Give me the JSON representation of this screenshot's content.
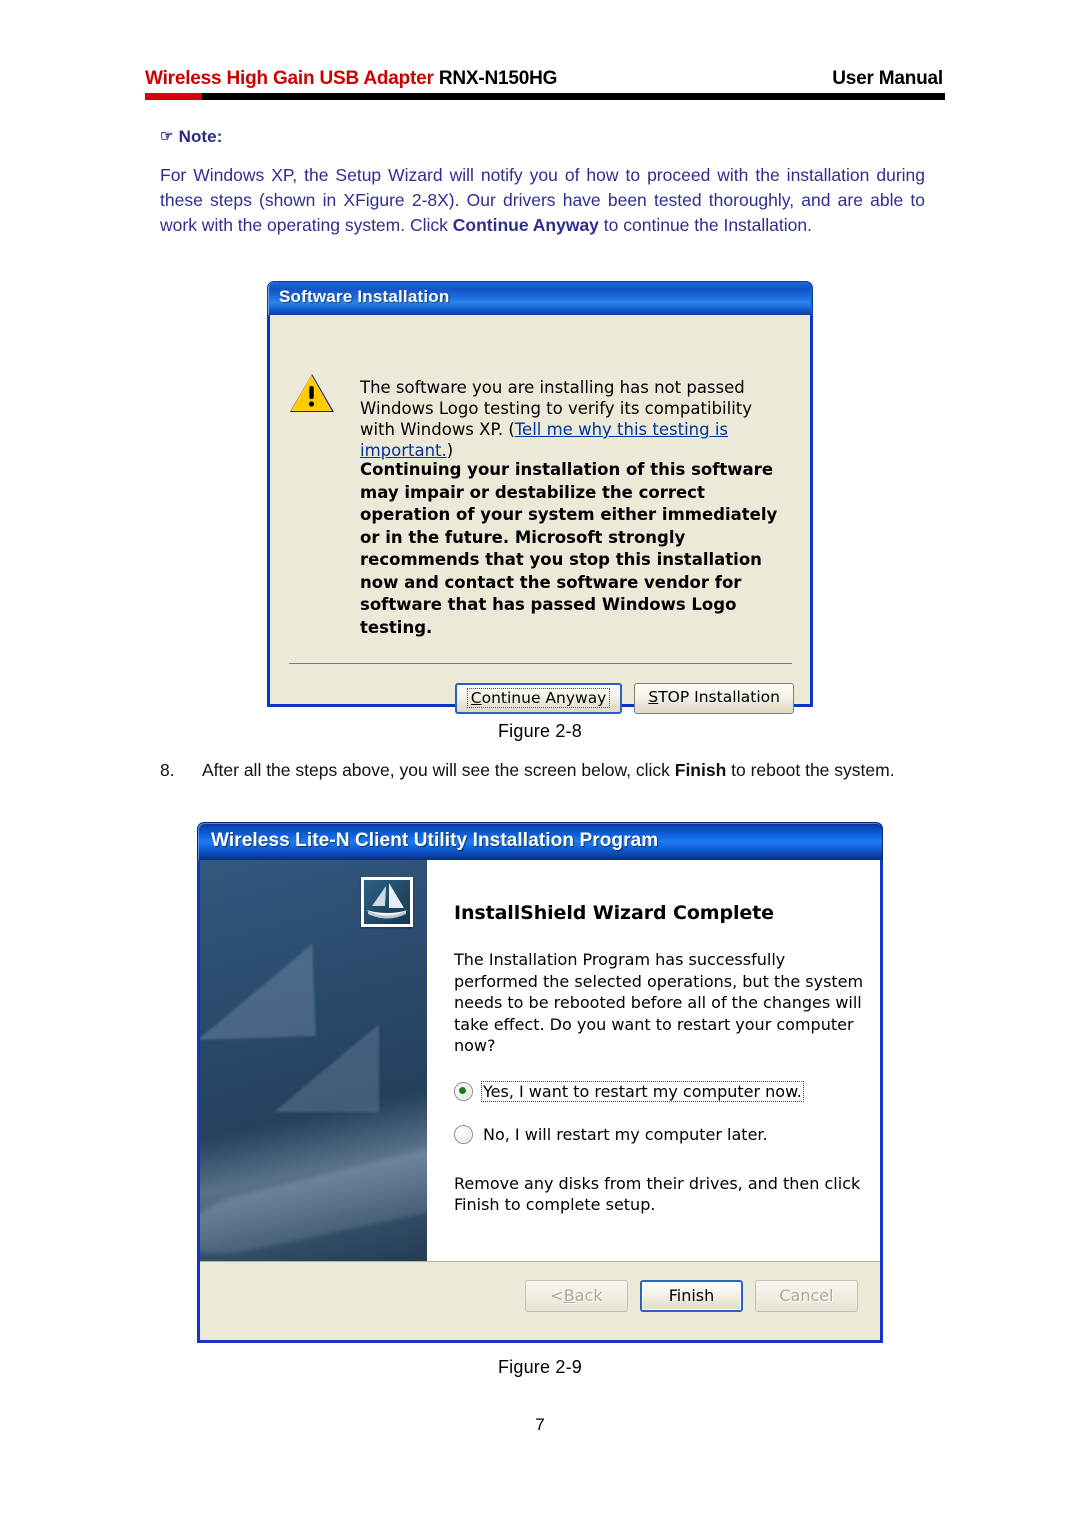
{
  "header": {
    "title_red": "Wireless High Gain USB Adapter",
    "title_black": " RNX-N150HG",
    "right": "User Manual",
    "rule_red": "#d8000f",
    "rule_black": "#000000"
  },
  "note": {
    "hand_icon": "☞",
    "title": "Note:",
    "body_part1": "For Windows XP, the Setup Wizard will notify you of how to proceed with the installation during these steps (shown in XFigure 2-8X). Our drivers have been tested thoroughly, and are able to work with the operating system. Click ",
    "body_bold": "Continue Anyway",
    "body_part2": " to continue the Installation.",
    "color": "#2e2e91"
  },
  "software_dialog": {
    "title": "Software Installation",
    "warn_icon": "warning-triangle-icon",
    "message_1a": "The software you are installing has not passed Windows Logo testing to verify its compatibility with Windows XP. (",
    "message_link": "Tell me why this testing is important.",
    "message_1b": ")",
    "message_2": "Continuing your installation of this software may impair or destabilize the correct operation of your system either immediately or in the future. Microsoft strongly recommends that you stop this installation now and contact the software vendor for software that has passed Windows Logo testing.",
    "buttons": {
      "continue_accel": "C",
      "continue_rest": "ontinue Anyway",
      "stop_accel": "S",
      "stop_rest": "TOP Installation"
    },
    "titlebar_color": "#1453c8",
    "border_color": "#0a36c4",
    "face_color": "#ece9d8"
  },
  "figure_28_caption": "Figure 2-8",
  "step8": {
    "number": "8.",
    "text_part1": "After all the steps above, you will see the screen below, click ",
    "text_bold": "Finish",
    "text_part2": " to reboot the system."
  },
  "installshield": {
    "title": "Wireless Lite-N Client Utility Installation Program",
    "sidebar_icon": "installshield-sail-icon",
    "heading": "InstallShield Wizard Complete",
    "paragraph": "The Installation Program has successfully performed the selected operations, but the system needs to be rebooted before all of the changes will take effect. Do you want to restart your computer now?",
    "radio_yes": "Yes, I want to restart my computer now.",
    "radio_no": "No, I will restart my computer later.",
    "radio_selected": "yes",
    "paragraph_2": "Remove any disks from their drives, and then click Finish to complete setup.",
    "buttons": {
      "back_prefix": "< ",
      "back_accel": "B",
      "back_rest": "ack",
      "finish": "Finish",
      "cancel": "Cancel",
      "back_enabled": false,
      "cancel_enabled": false,
      "finish_default": true
    },
    "titlebar_color": "#0f62e0",
    "border_color": "#1535c8",
    "sidebar_color": "#2b4c6e"
  },
  "figure_29_caption": "Figure 2-9",
  "page_number": "7"
}
